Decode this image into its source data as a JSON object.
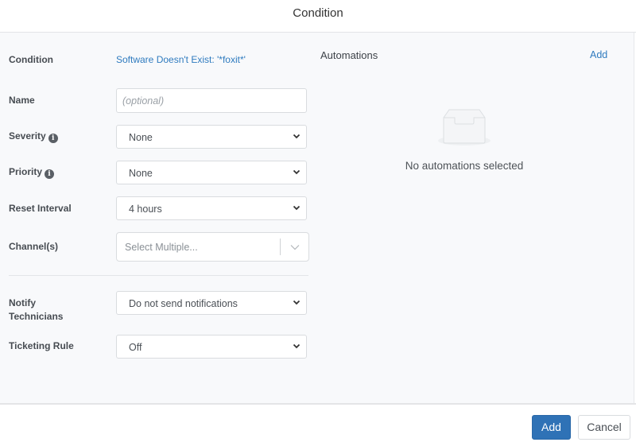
{
  "header": {
    "title": "Condition"
  },
  "form": {
    "condition": {
      "label": "Condition",
      "value": "Software Doesn't Exist: '*foxit*'"
    },
    "name": {
      "label": "Name",
      "value": "",
      "placeholder": "(optional)"
    },
    "severity": {
      "label": "Severity",
      "info_icon": "info-icon",
      "selected": "None"
    },
    "priority": {
      "label": "Priority",
      "info_icon": "info-icon",
      "selected": "None"
    },
    "reset_interval": {
      "label": "Reset Interval",
      "selected": "4 hours"
    },
    "channels": {
      "label": "Channel(s)",
      "placeholder": "Select Multiple..."
    },
    "notify_technicians": {
      "label_line1": "Notify",
      "label_line2": "Technicians",
      "selected": "Do not send notifications"
    },
    "ticketing_rule": {
      "label": "Ticketing Rule",
      "selected": "Off"
    }
  },
  "automations": {
    "title": "Automations",
    "add_label": "Add",
    "empty_icon": "inbox-icon",
    "empty_text": "No automations selected"
  },
  "footer": {
    "add_label": "Add",
    "cancel_label": "Cancel"
  },
  "colors": {
    "link": "#2f7bbf",
    "primary_button": "#2f72b6",
    "panel_bg": "#f8f9fb"
  }
}
